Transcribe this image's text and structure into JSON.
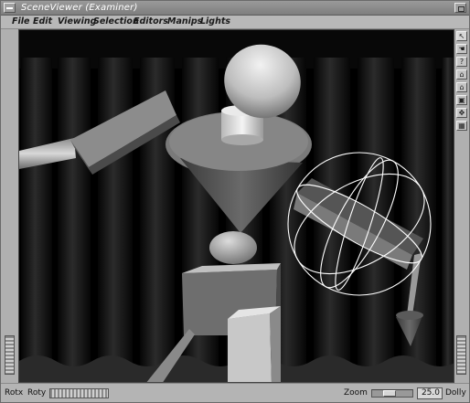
{
  "window": {
    "title": "SceneViewer (Examiner)"
  },
  "menubar": {
    "items": [
      "File",
      "Edit",
      "Viewing",
      "Selection",
      "Editors",
      "Manips",
      "Lights"
    ]
  },
  "right_toolbar": {
    "buttons": [
      {
        "icon": "arrow-pointer-icon",
        "glyph": "↖"
      },
      {
        "icon": "hand-view-icon",
        "glyph": "☚"
      },
      {
        "icon": "help-icon",
        "glyph": "?"
      },
      {
        "icon": "home-icon",
        "glyph": "⌂"
      },
      {
        "icon": "set-home-icon",
        "glyph": "⌂"
      },
      {
        "icon": "view-all-icon",
        "glyph": "▣"
      },
      {
        "icon": "seek-icon",
        "glyph": "✥"
      },
      {
        "icon": "projection-icon",
        "glyph": "▦"
      }
    ]
  },
  "bottombar": {
    "rotx_label": "Rotx",
    "roty_label": "Roty",
    "zoom_label": "Zoom",
    "zoom_value": "25.0",
    "dolly_label": "Dolly"
  },
  "colors": {
    "background": "#000000",
    "drapes": "#1c1c1c",
    "shape_light": "#d8d8d8",
    "shape_mid": "#7a7a7a",
    "manip_lines": "#ffffff"
  }
}
